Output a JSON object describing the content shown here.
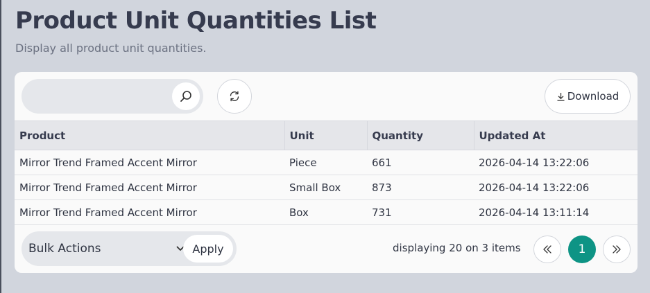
{
  "header": {
    "title": "Product Unit Quantities List",
    "subtitle": "Display all product unit quantities."
  },
  "toolbar": {
    "search_placeholder": "",
    "download_label": "Download"
  },
  "table": {
    "columns": [
      "Product",
      "Unit",
      "Quantity",
      "Updated At"
    ],
    "rows": [
      [
        "Mirror Trend Framed Accent Mirror",
        "Piece",
        "661",
        "2026-04-14 13:22:06"
      ],
      [
        "Mirror Trend Framed Accent Mirror",
        "Small Box",
        "873",
        "2026-04-14 13:22:06"
      ],
      [
        "Mirror Trend Framed Accent Mirror",
        "Box",
        "731",
        "2026-04-14 13:11:14"
      ]
    ]
  },
  "footer": {
    "bulk_actions_label": "Bulk Actions",
    "apply_label": "Apply",
    "display_info": "displaying 20 on 3 items",
    "current_page": "1"
  },
  "icons": {
    "search": "search-icon",
    "refresh": "refresh-icon",
    "download": "download-icon",
    "chevron": "chevron-down-icon",
    "first": "double-chevron-left-icon",
    "last": "double-chevron-right-icon"
  },
  "colors": {
    "accent": "#0e9485",
    "background": "#d1d5dd"
  }
}
